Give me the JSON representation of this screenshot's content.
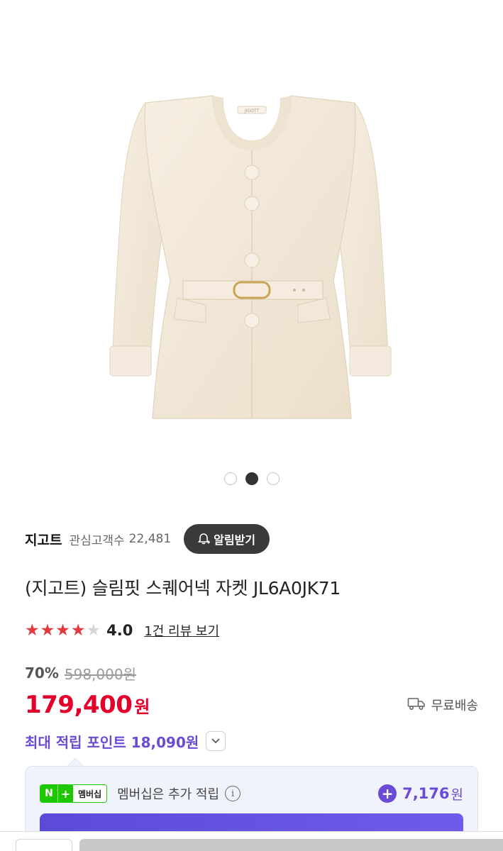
{
  "carousel": {
    "count": 3,
    "active_index": 1
  },
  "product_image": {
    "label_text": "JIGOTT",
    "jacket_color": "#f3e9da"
  },
  "brand": {
    "name": "지고트",
    "follower_label": "관심고객수",
    "follower_count": "22,481",
    "alarm_button_label": "알림받기"
  },
  "product": {
    "title": "(지고트) 슬림핏 스퀘어넥 자켓 JL6A0JK71"
  },
  "rating": {
    "value": "4.0",
    "stars_filled": 4,
    "stars_total": 5,
    "review_link": "1건 리뷰 보기"
  },
  "pricing": {
    "discount_rate": "70%",
    "original_price": "598,000원",
    "sale_amount": "179,400",
    "sale_unit": "원",
    "shipping_label": "무료배송"
  },
  "points": {
    "max_points_label": "최대 적립 포인트 18,090원"
  },
  "membership": {
    "badge_n": "N",
    "badge_plus": "+",
    "badge_text": "멤버십",
    "description": "멤버십은 추가 적립",
    "info_symbol": "i",
    "plus_symbol": "+",
    "amount": "7,176",
    "unit": "원"
  },
  "colors": {
    "accent_red": "#e4002b",
    "accent_purple": "#6b4bd6",
    "naver_green": "#1ec800"
  }
}
